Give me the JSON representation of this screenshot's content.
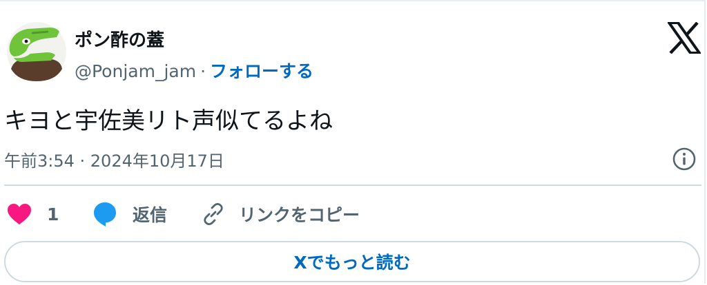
{
  "author": {
    "display_name": "ポン酢の蓋",
    "handle": "@Ponjam_jam",
    "separator": "·",
    "follow_label": "フォローする"
  },
  "tweet": {
    "text": "キヨと宇佐美リト声似てるよね",
    "timestamp": "午前3:54 · 2024年10月17日"
  },
  "actions": {
    "like_count": "1",
    "reply_label": "返信",
    "copy_link_label": "リンクをコピー"
  },
  "read_more_label": "Xでもっと読む",
  "icons": {
    "brand": "x-logo-icon",
    "info": "info-icon",
    "like": "heart-icon",
    "reply": "speech-bubble-icon",
    "copy": "link-icon"
  },
  "colors": {
    "accent_blue": "#0069c2",
    "like_pink": "#f91880",
    "reply_blue": "#1d9bf0",
    "muted_text": "#536471",
    "avatar_green": "#6fc43c",
    "avatar_brown": "#5a3e2b"
  }
}
